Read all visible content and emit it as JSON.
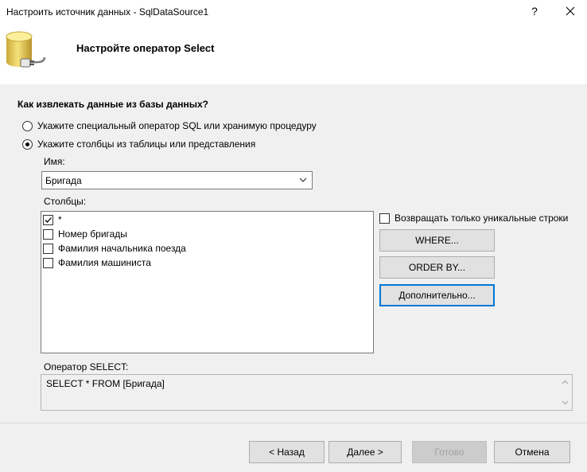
{
  "window": {
    "title": "Настроить источник данных - SqlDataSource1",
    "help_label": "?"
  },
  "header": {
    "title": "Настройте оператор Select"
  },
  "form": {
    "question": "Как извлекать данные из базы данных?",
    "radio_custom_sql": "Укажите специальный оператор SQL или хранимую процедуру",
    "radio_columns": "Укажите столбцы из таблицы или представления",
    "name_label": "Имя:",
    "name_value": "Бригада",
    "columns_label": "Столбцы:",
    "columns": [
      {
        "label": "*",
        "checked": true
      },
      {
        "label": "Номер бригады",
        "checked": false
      },
      {
        "label": "Фамилия начальника поезда",
        "checked": false
      },
      {
        "label": "Фамилия машиниста",
        "checked": false
      }
    ],
    "unique_rows_label": "Возвращать только уникальные строки",
    "where_button": "WHERE...",
    "orderby_button": "ORDER BY...",
    "advanced_button": "Дополнительно...",
    "select_label": "Оператор SELECT:",
    "select_statement": "SELECT * FROM [Бригада]"
  },
  "footer": {
    "back_button": "< Назад",
    "next_button": "Далее >",
    "finish_button": "Готово",
    "cancel_button": "Отмена"
  },
  "icons": {
    "window": "database-plug-icon",
    "close": "close-icon",
    "dropdown": "chevron-down-icon"
  },
  "colors": {
    "focus_border": "#0078d7",
    "header_bg": "#ffffff",
    "body_bg": "#f0f0f0"
  }
}
